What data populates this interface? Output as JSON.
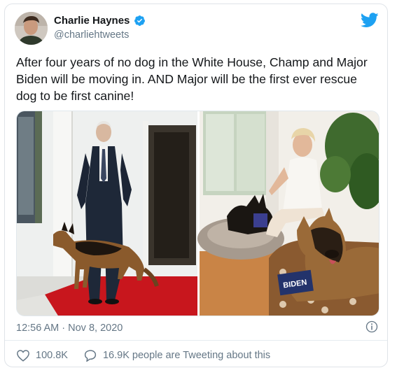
{
  "tweet": {
    "author_name": "Charlie Haynes",
    "author_handle": "@charliehtweets",
    "text": "After four years of no dog in the White House, Champ and Major Biden will be moving in. AND Major will be the first ever rescue dog to be first canine!",
    "timestamp": "12:56 AM · Nov 8, 2020",
    "likes": "100.8K",
    "retweet_text": "16.9K people are Tweeting about this"
  },
  "media": {
    "left_photo_sign": "",
    "right_pillow_text": "BIDEN"
  },
  "icons": {
    "verified": "verified-badge-icon",
    "platform": "twitter-bird-icon",
    "info": "info-icon",
    "like": "heart-icon",
    "reply": "speech-bubble-icon"
  },
  "colors": {
    "accent": "#1da1f2",
    "text": "#14171a",
    "secondary": "#657786",
    "red_carpet": "#c8161d"
  }
}
